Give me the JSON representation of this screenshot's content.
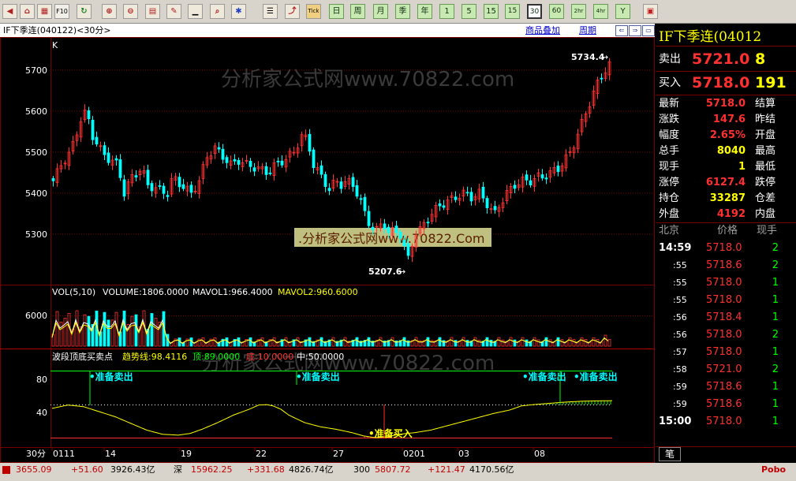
{
  "window": {
    "symbol_title": "IF下季连(040122)<30分>",
    "product_overlay_link": "商品叠加",
    "period_link": "周期"
  },
  "toolbar": {
    "text_buttons": [
      "F10",
      "Tick",
      "日",
      "周",
      "月",
      "季",
      "年",
      "1",
      "5",
      "15",
      "30",
      "60",
      "2hr",
      "4hr",
      "Y"
    ],
    "selected": "30"
  },
  "price_axis": {
    "panel_label": "K",
    "ticks": [
      "5700",
      "5600",
      "5500",
      "5400",
      "5300"
    ],
    "high_label": "5734.4",
    "low_label": "5207.6"
  },
  "watermark": {
    "text_main": "分析家公式网www.70822.com",
    "text_box": ".分析家公式网www.70822.Com"
  },
  "volume": {
    "legend_vol": "VOL(5,10)",
    "legend_volume": "VOLUME:1806.0000",
    "legend_ma1": "MAVOL1:966.4000",
    "legend_ma2": "MAVOL2:960.6000",
    "tick": "6000"
  },
  "indicator": {
    "name": "波段顶底买卖点",
    "trend_label": "趋势线:98.4116",
    "top_label": "顶:89.0000",
    "bottom_label": "底:10.0000",
    "mid_label": "中:50.0000",
    "ticks": [
      "80",
      "40"
    ],
    "signals": {
      "sell": "•准备卖出",
      "buy": "•准备买入"
    }
  },
  "date_axis": {
    "period": "30分",
    "dates": [
      "0111",
      "14",
      "19",
      "22",
      "27",
      "0201",
      "03",
      "08"
    ]
  },
  "quote": {
    "title": "IF下季连(04012",
    "ask": {
      "label": "卖出",
      "price": "5721.0",
      "vol": "8"
    },
    "bid": {
      "label": "买入",
      "price": "5718.0",
      "vol": "191"
    },
    "stats": [
      {
        "label": "最新",
        "value": "5718.0",
        "right": "结算"
      },
      {
        "label": "涨跌",
        "value": "147.6",
        "right": "昨结"
      },
      {
        "label": "幅度",
        "value": "2.65%",
        "right": "开盘"
      },
      {
        "label": "总手",
        "value": "8040",
        "right": "最高"
      },
      {
        "label": "现手",
        "value": "1",
        "right": "最低"
      },
      {
        "label": "涨停",
        "value": "6127.4",
        "right": "跌停"
      },
      {
        "label": "持仓",
        "value": "33287",
        "right": "仓差"
      },
      {
        "label": "外盘",
        "value": "4192",
        "right": "内盘"
      }
    ],
    "ticks_header": {
      "time": "北京",
      "price": "价格",
      "qty": "现手"
    },
    "ticks": [
      {
        "time": "14:59",
        "price": "5718.0",
        "qty": "2"
      },
      {
        "time": ":55",
        "price": "5718.6",
        "qty": "2"
      },
      {
        "time": ":55",
        "price": "5718.0",
        "qty": "1"
      },
      {
        "time": ":55",
        "price": "5718.0",
        "qty": "1"
      },
      {
        "time": ":56",
        "price": "5718.4",
        "qty": "1"
      },
      {
        "time": ":56",
        "price": "5718.0",
        "qty": "2"
      },
      {
        "time": ":57",
        "price": "5718.0",
        "qty": "1"
      },
      {
        "time": ":58",
        "price": "5721.0",
        "qty": "2"
      },
      {
        "time": ":59",
        "price": "5718.6",
        "qty": "1"
      },
      {
        "time": ":59",
        "price": "5718.6",
        "qty": "1"
      },
      {
        "time": "15:00",
        "price": "5718.0",
        "qty": "1"
      }
    ],
    "tab": "笔"
  },
  "status": {
    "items": [
      {
        "text": "3655.09",
        "color": "#c00000"
      },
      {
        "text": "+51.60",
        "color": "#c00000"
      },
      {
        "text": "3926.43亿",
        "color": "#000000"
      },
      {
        "text": "深",
        "color": "#000000"
      },
      {
        "text": "15962.25",
        "color": "#c00000"
      },
      {
        "text": "+331.68",
        "color": "#c00000"
      },
      {
        "text": "4826.74亿",
        "color": "#000000"
      },
      {
        "text": "300",
        "color": "#000000"
      },
      {
        "text": "5807.72",
        "color": "#c00000"
      },
      {
        "text": "+121.47",
        "color": "#c00000"
      },
      {
        "text": "4170.56亿",
        "color": "#000000"
      }
    ],
    "brand": "Pobo"
  },
  "colors": {
    "up": "#ff3333",
    "down": "#00ffff",
    "grid": "#7a0000",
    "yellow": "#ffff00",
    "green": "#00ff00",
    "ma_white": "#ffffff"
  }
}
